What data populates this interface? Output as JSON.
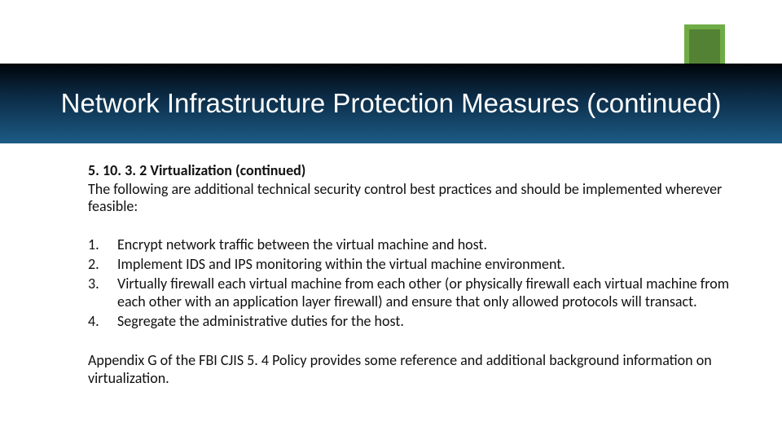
{
  "title": "Network Infrastructure Protection Measures (continued)",
  "section_heading": "5. 10. 3. 2 Virtualization (continued)",
  "intro": "The following are additional technical security control best practices and should be implemented wherever feasible:",
  "items": {
    "i1": {
      "marker": "1.",
      "text": "Encrypt network traffic between the virtual machine and host."
    },
    "i2": {
      "marker": "2.",
      "text": "Implement IDS and IPS monitoring within the virtual machine environment."
    },
    "i3": {
      "marker": "3.",
      "text": "Virtually firewall each virtual machine from each other (or physically firewall each virtual machine from each other with an application layer firewall) and ensure that only allowed protocols will transact."
    },
    "i4": {
      "marker": "4.",
      "text": "Segregate the administrative duties for the host."
    }
  },
  "closing": "Appendix G of the FBI CJIS 5. 4 Policy provides some reference and additional background information on virtualization."
}
